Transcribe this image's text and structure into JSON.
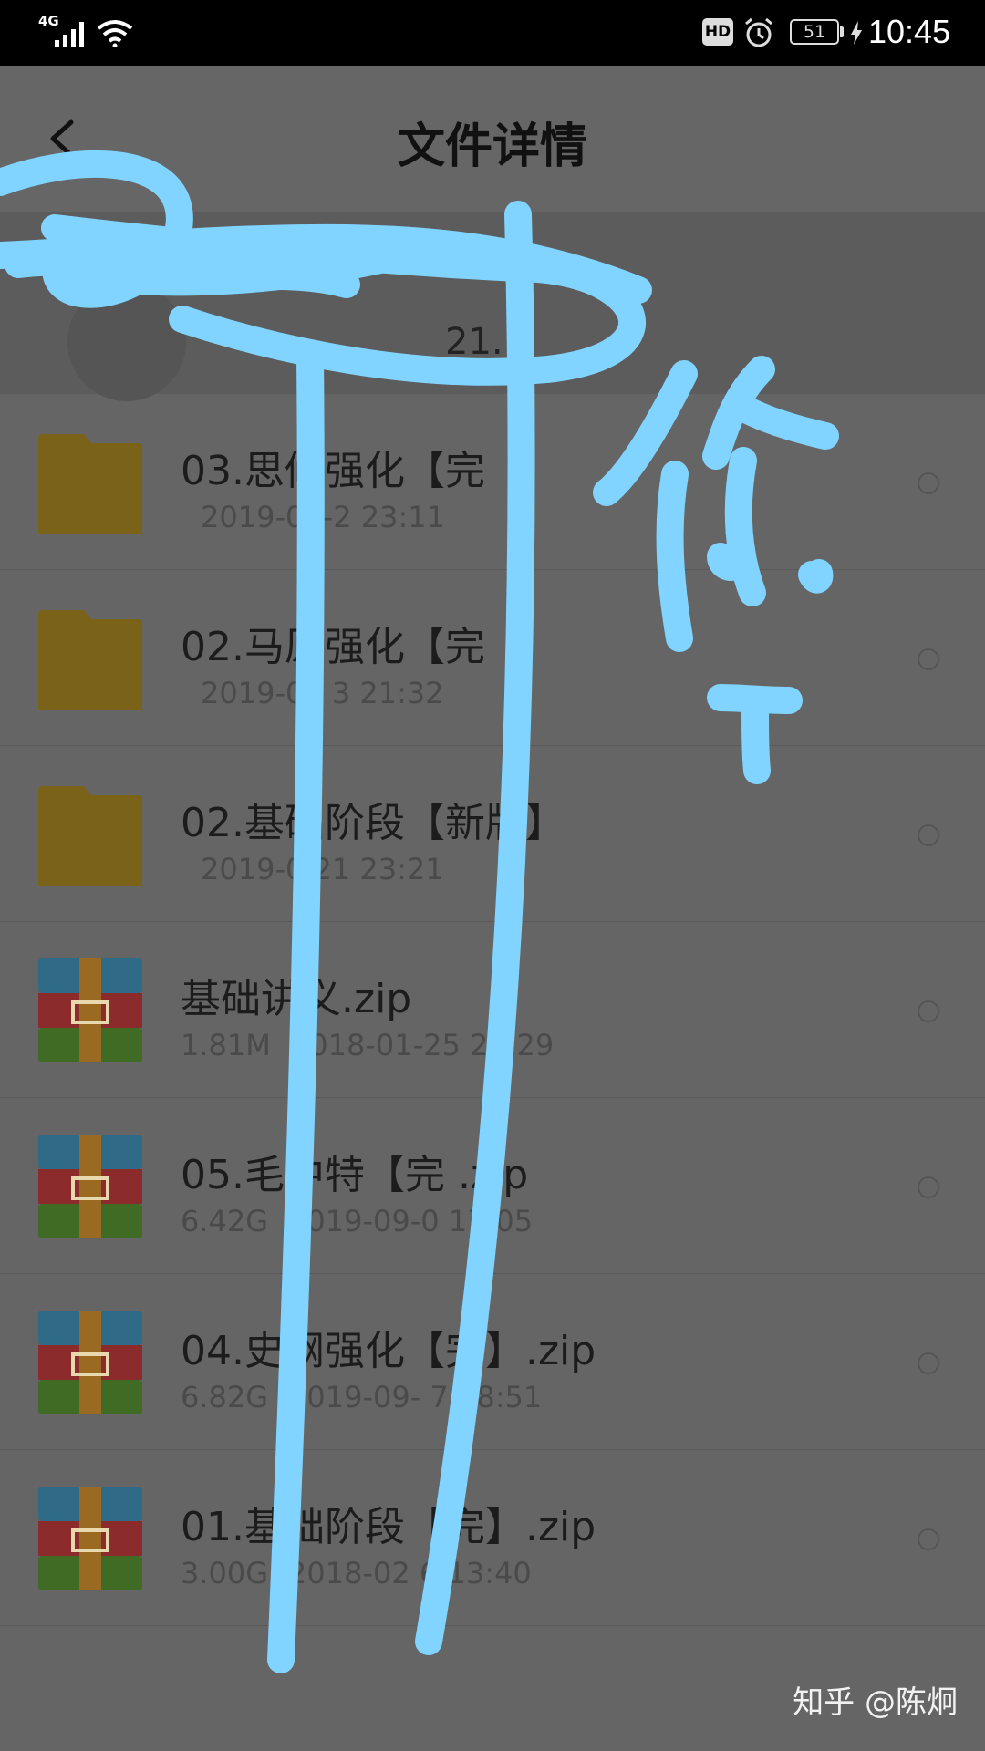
{
  "status_bar": {
    "network": "4G",
    "hd_badge": "HD",
    "battery": "51",
    "time": "10:45"
  },
  "header": {
    "title": "文件详情"
  },
  "source": {
    "partial_text": "21."
  },
  "files": [
    {
      "type": "folder",
      "name": "03.思修强化【完",
      "size": "",
      "date": "2019-06-2  23:11"
    },
    {
      "type": "folder",
      "name": "02.马原强化【完",
      "size": "",
      "date": "2019-05  3  21:32"
    },
    {
      "type": "folder",
      "name": "02.基础阶段【新版】",
      "size": "",
      "date": "2019-0  21  23:21"
    },
    {
      "type": "zip",
      "name": "基础讲义.zip",
      "size": "1.81M",
      "date": "2018-01-25  21:29"
    },
    {
      "type": "zip",
      "name": "05.毛中特【完  .zip",
      "size": "6.42G",
      "date": "2019-09-0  17:05"
    },
    {
      "type": "zip",
      "name": "04.史纲强化【完】.zip",
      "size": "6.82G",
      "date": "2019-09-  7  18:51"
    },
    {
      "type": "zip",
      "name": "01.基础阶段【完】.zip",
      "size": "3.00G",
      "date": "2018-02  6  13:40"
    }
  ],
  "watermark": "知乎 @陈炯",
  "colors": {
    "folder": "#7a6318",
    "scribble": "#80d4ff",
    "zip_blue": "#2f6a86",
    "zip_red": "#8b2b2b",
    "zip_green": "#3f6b25",
    "zip_band": "#9a6a22"
  }
}
